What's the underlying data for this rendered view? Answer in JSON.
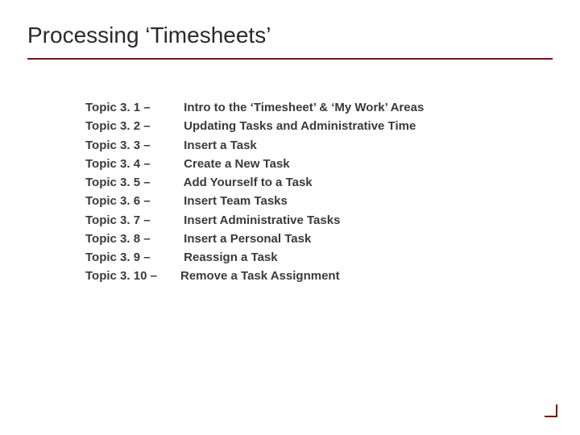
{
  "title": "Processing ‘Timesheets’",
  "topics": [
    {
      "num": "Topic 3. 1 – ",
      "desc": " Intro to the ‘Timesheet’ & ‘My Work’ Areas"
    },
    {
      "num": "Topic 3. 2 – ",
      "desc": " Updating Tasks and Administrative Time"
    },
    {
      "num": "Topic 3. 3 – ",
      "desc": " Insert a Task"
    },
    {
      "num": "Topic 3. 4 – ",
      "desc": " Create a New Task"
    },
    {
      "num": "Topic 3. 5 – ",
      "desc": " Add Yourself to a Task"
    },
    {
      "num": "Topic 3. 6 – ",
      "desc": " Insert Team Tasks"
    },
    {
      "num": "Topic 3. 7 – ",
      "desc": " Insert Administrative Tasks"
    },
    {
      "num": "Topic 3. 8 – ",
      "desc": " Insert a Personal Task"
    },
    {
      "num": "Topic 3. 9 – ",
      "desc": " Reassign a Task"
    },
    {
      "num": "Topic 3. 10 – ",
      "desc": "Remove a Task Assignment"
    }
  ]
}
